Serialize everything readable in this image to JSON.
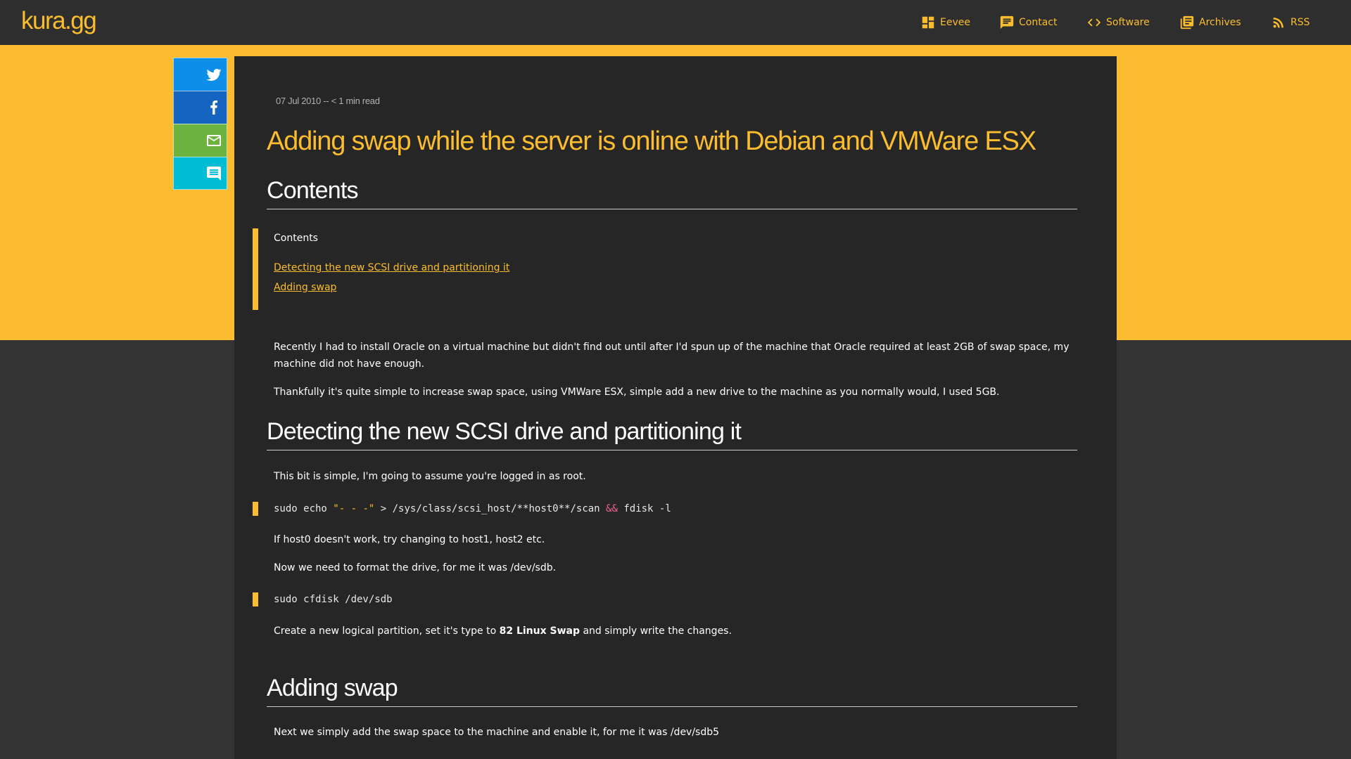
{
  "header": {
    "logo": "kura.gg",
    "nav": [
      {
        "label": "Eevee",
        "icon": "dashboard-icon"
      },
      {
        "label": "Contact",
        "icon": "chat-icon"
      },
      {
        "label": "Software",
        "icon": "code-icon"
      },
      {
        "label": "Archives",
        "icon": "library-icon"
      },
      {
        "label": "RSS",
        "icon": "rss-icon"
      }
    ]
  },
  "share": {
    "buttons": [
      {
        "name": "twitter",
        "icon": "twitter-icon",
        "color": "#0d8ee8"
      },
      {
        "name": "facebook",
        "icon": "facebook-icon",
        "color": "#1565c0"
      },
      {
        "name": "email",
        "icon": "mail-icon",
        "color": "#6db33f"
      },
      {
        "name": "comment",
        "icon": "comment-icon",
        "color": "#00bcd4"
      }
    ]
  },
  "article": {
    "meta": "07 Jul 2010 -- < 1 min read",
    "title": "Adding swap while the server is online with Debian and VMWare ESX",
    "contents_heading": "Contents",
    "toc": {
      "title": "Contents",
      "links": [
        "Detecting the new SCSI drive and partitioning it",
        "Adding swap"
      ]
    },
    "intro_p1": "Recently I had to install Oracle on a virtual machine but didn't find out until after I'd spun up of the machine that Oracle required at least 2GB of swap space, my machine did not have enough.",
    "intro_p2": "Thankfully it's quite simple to increase swap space, using VMWare ESX, simple add a new drive to the machine as you normally would, I used 5GB.",
    "section1_heading": "Detecting the new SCSI drive and partitioning it",
    "s1_p1": "This bit is simple, I'm going to assume you're logged in as root.",
    "code1": {
      "pre": "sudo echo ",
      "str": "\"- - -\"",
      "mid": " > /sys/class/scsi_host/**host0**/scan ",
      "op": "&&",
      "post": " fdisk -l"
    },
    "s1_p2": "If host0 doesn't work, try changing to host1, host2 etc.",
    "s1_p3": "Now we need to format the drive, for me it was /dev/sdb.",
    "code2": "sudo cfdisk /dev/sdb",
    "s1_p4_pre": "Create a new logical partition, set it's type to ",
    "s1_p4_bold": "82 Linux Swap",
    "s1_p4_post": " and simply write the changes.",
    "section2_heading": "Adding swap",
    "s2_p1": "Next we simply add the swap space to the machine and enable it, for me it was /dev/sdb5"
  },
  "colors": {
    "accent": "#fbbd2f",
    "header_bg": "#2e2e2e",
    "page_bg": "#333333",
    "article_bg": "#262626"
  }
}
